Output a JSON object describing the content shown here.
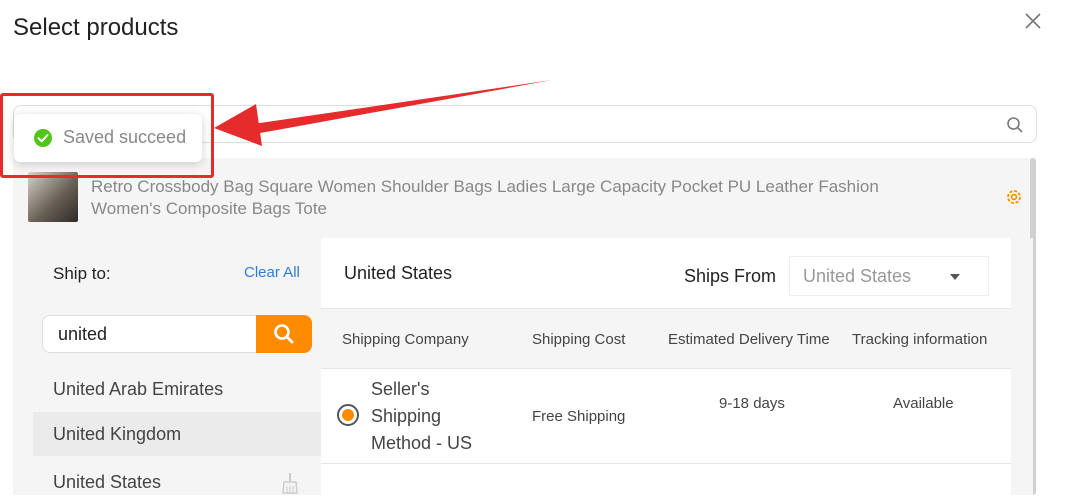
{
  "dialog": {
    "title": "Select products"
  },
  "product": {
    "name": "Retro Crossbody Bag Square Women Shoulder Bags Ladies Large Capacity Pocket PU Leather Fashion Women's Composite Bags Tote"
  },
  "shipping": {
    "ship_to_label": "Ship to:",
    "clear_all": "Clear All",
    "country_search_value": "united",
    "countries": [
      "United Arab Emirates",
      "United Kingdom",
      "United States"
    ],
    "selected_country": "United States",
    "ships_from_label": "Ships From",
    "ships_from_value": "United States",
    "headers": [
      "Shipping Company",
      "Shipping Cost",
      "Estimated Delivery Time",
      "Tracking information"
    ],
    "rows": [
      {
        "company": "Seller's Shipping Method - US",
        "cost": "Free Shipping",
        "delivery": "9-18 days",
        "tracking": "Available"
      }
    ]
  },
  "toast": {
    "text": "Saved succeed"
  },
  "colors": {
    "accent": "#ff8c00",
    "link": "#2e7bd6",
    "success": "#52c41a",
    "annotation": "#e52b2b"
  },
  "icons": [
    "close-icon",
    "search-icon",
    "gear-icon",
    "check-circle-icon",
    "broom-icon",
    "caret-down-icon"
  ]
}
